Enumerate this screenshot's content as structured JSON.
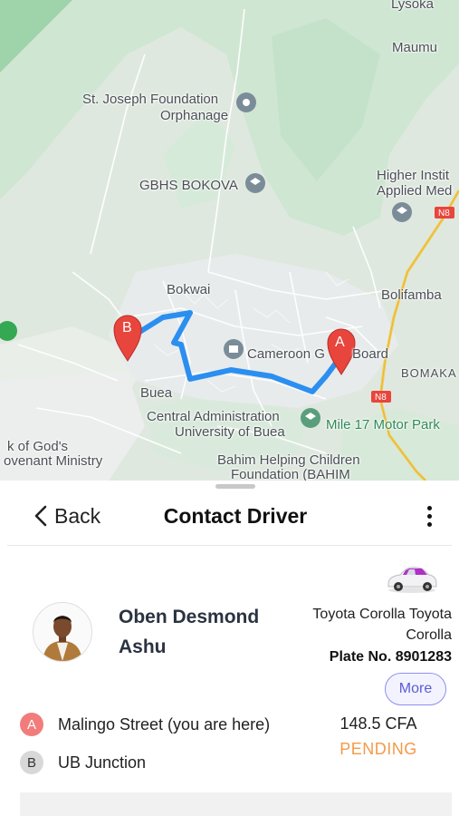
{
  "map": {
    "labels": {
      "lysoka": "Lysoka",
      "maumu": "Maumu",
      "st_joseph": "St. Joseph Foundation",
      "orphanage": "Orphanage",
      "gbhs": "GBHS BOKOVA",
      "higher_1": "Higher Instit",
      "higher_2": "Applied Med",
      "n8_top": "N8",
      "bokwai": "Bokwai",
      "bolifamba": "Bolifamba",
      "cameroon_gce": "Cameroon G",
      "board": "Board",
      "bomaka": "BOMAKA",
      "buea": "Buea",
      "n8_bottom": "N8",
      "central_admin_1": "Central Administration",
      "central_admin_2": "University of Buea",
      "mile17": "Mile 17 Motor Park",
      "kof_gods": "k of God's",
      "covenant": "ovenant Ministry",
      "bahim_1": "Bahim Helping Children",
      "bahim_2": "Foundation (BAHIM"
    },
    "marker_a": "A",
    "marker_b": "B"
  },
  "header": {
    "back_label": "Back",
    "title": "Contact Driver"
  },
  "driver": {
    "name": "Oben Desmond Ashu",
    "car_model": "Toyota Corolla Toyota Corolla",
    "plate": "Plate No. 8901283",
    "more_label": "More"
  },
  "trip": {
    "pickup_badge": "A",
    "pickup": "Malingo Street (you are here)",
    "dropoff_badge": "B",
    "dropoff": "UB Junction",
    "fare": "148.5 CFA",
    "status": "PENDING"
  },
  "colors": {
    "route": "#2b8ff0",
    "marker": "#e8453c",
    "status": "#f39a4a",
    "accent": "#5b5bd6"
  }
}
